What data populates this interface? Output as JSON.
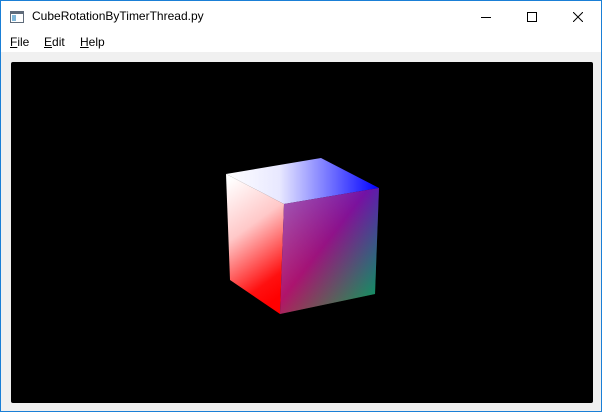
{
  "window": {
    "title": "CubeRotationByTimerThread.py",
    "app_icon": "window-app-icon",
    "controls": {
      "minimize_icon": "minimize-icon",
      "maximize_icon": "maximize-icon",
      "close_icon": "close-icon"
    }
  },
  "menubar": {
    "items": [
      {
        "mnemonic": "F",
        "rest": "ile"
      },
      {
        "mnemonic": "E",
        "rest": "dit"
      },
      {
        "mnemonic": "H",
        "rest": "elp"
      }
    ]
  },
  "viewport": {
    "background": "#000000",
    "cube_colors": {
      "white": "#ffffff",
      "red": "#ff0000",
      "green": "#00ff00",
      "blue": "#0000ff"
    }
  }
}
